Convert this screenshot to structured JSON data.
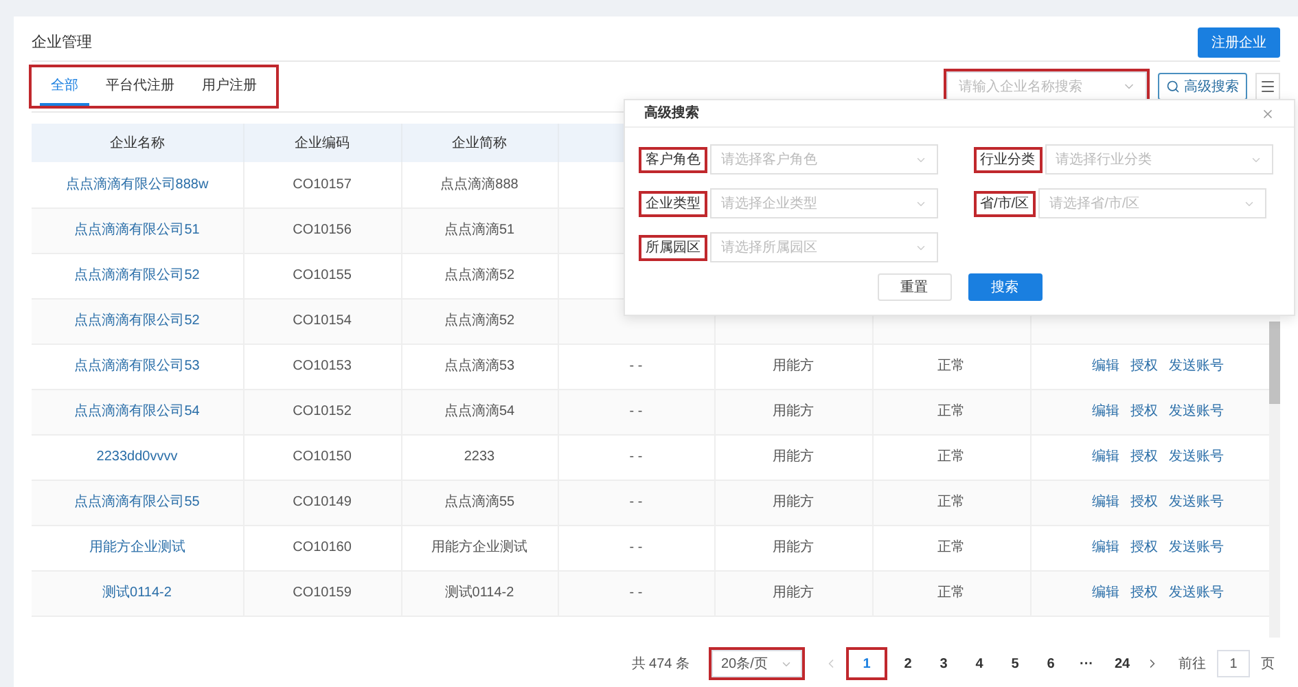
{
  "page": {
    "title": "企业管理",
    "register_button": "注册企业"
  },
  "tab_bar": {
    "annotated": true,
    "tabs": [
      {
        "label": "全部",
        "selected": true
      },
      {
        "label": "平台代注册",
        "selected": false
      },
      {
        "label": "用户注册",
        "selected": false
      }
    ]
  },
  "search": {
    "placeholder": "请输入企业名称搜索",
    "annotated": true
  },
  "advanced_button": "高级搜索",
  "table": {
    "columns": [
      "企业名称",
      "企业编码",
      "企业简称"
    ],
    "rows": [
      {
        "name": "点点滴滴有限公司888w",
        "code": "CO10157",
        "short": "点点滴滴888"
      },
      {
        "name": "点点滴滴有限公司51",
        "code": "CO10156",
        "short": "点点滴滴51"
      },
      {
        "name": "点点滴滴有限公司52",
        "code": "CO10155",
        "short": "点点滴滴52"
      },
      {
        "name": "点点滴滴有限公司52",
        "code": "CO10154",
        "short": "点点滴滴52"
      },
      {
        "name": "点点滴滴有限公司53",
        "code": "CO10153",
        "short": "点点滴滴53",
        "column_4": "- -",
        "column_5": "用能方",
        "column_6": "正常",
        "actions": [
          "编辑",
          "授权",
          "发送账号"
        ]
      },
      {
        "name": "点点滴滴有限公司54",
        "code": "CO10152",
        "short": "点点滴滴54",
        "column_4": "- -",
        "column_5": "用能方",
        "column_6": "正常",
        "actions": [
          "编辑",
          "授权",
          "发送账号"
        ]
      },
      {
        "name": "2233dd0vvvv",
        "code": "CO10150",
        "short": "2233",
        "column_4": "- -",
        "column_5": "用能方",
        "column_6": "正常",
        "actions": [
          "编辑",
          "授权",
          "发送账号"
        ]
      },
      {
        "name": "点点滴滴有限公司55",
        "code": "CO10149",
        "short": "点点滴滴55",
        "column_4": "- -",
        "column_5": "用能方",
        "column_6": "正常",
        "actions": [
          "编辑",
          "授权",
          "发送账号"
        ]
      },
      {
        "name": "用能方企业测试",
        "code": "CO10160",
        "short": "用能方企业测试",
        "column_4": "- -",
        "column_5": "用能方",
        "column_6": "正常",
        "actions": [
          "编辑",
          "授权",
          "发送账号"
        ]
      },
      {
        "name": "测试0114-2",
        "code": "CO10159",
        "short": "测试0114-2",
        "column_4": "- -",
        "column_5": "用能方",
        "column_6": "正常",
        "actions": [
          "编辑",
          "授权",
          "发送账号"
        ]
      }
    ]
  },
  "advanced_search": {
    "title": "高级搜索",
    "fields": [
      {
        "label": "客户角色",
        "placeholder": "请选择客户角色",
        "annotated": true
      },
      {
        "label": "行业分类",
        "placeholder": "请选择行业分类",
        "annotated": true
      },
      {
        "label": "企业类型",
        "placeholder": "请选择企业类型",
        "annotated": true
      },
      {
        "label": "省/市/区",
        "placeholder": "请选择省/市/区",
        "annotated": true
      },
      {
        "label": "所属园区",
        "placeholder": "请选择所属园区",
        "annotated": true
      }
    ],
    "buttons": [
      {
        "label": "重置",
        "kind": "secondary"
      },
      {
        "label": "搜索",
        "kind": "primary"
      }
    ]
  },
  "pagination": {
    "total": "共 474 条",
    "page_size": "20条/页",
    "page_size_annotated": true,
    "pages": [
      {
        "label": "1",
        "selected": true,
        "annotated": true
      },
      {
        "label": "2",
        "selected": false,
        "annotated": false
      },
      {
        "label": "3",
        "selected": false,
        "annotated": false
      },
      {
        "label": "4",
        "selected": false,
        "annotated": false
      },
      {
        "label": "5",
        "selected": false,
        "annotated": false
      },
      {
        "label": "6",
        "selected": false,
        "annotated": false
      },
      {
        "label": "···",
        "selected": false,
        "annotated": false
      },
      {
        "label": "24",
        "selected": false,
        "annotated": false
      }
    ],
    "goto_label": "前往",
    "goto_value": "1",
    "goto_suffix": "页"
  }
}
